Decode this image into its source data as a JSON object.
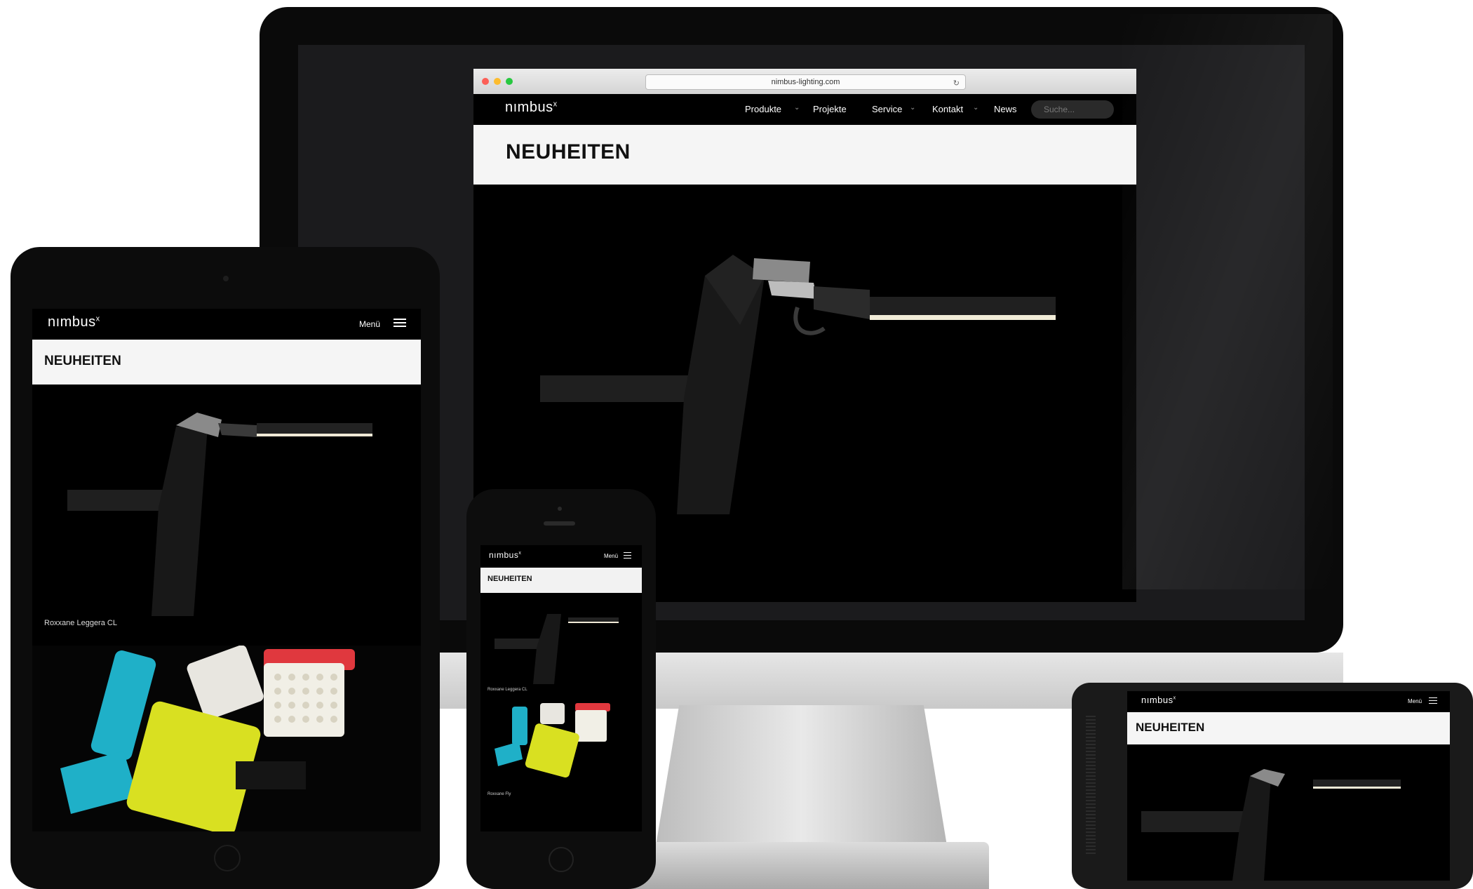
{
  "desktop": {
    "url": "nimbus-lighting.com",
    "logo": "nımbus",
    "logo_mark": "x",
    "nav": [
      "Produkte",
      "Projekte",
      "Service",
      "Kontakt",
      "News"
    ],
    "search_placeholder": "Suche...",
    "page_title": "NEUHEITEN"
  },
  "tablet": {
    "logo": "nımbus",
    "logo_mark": "x",
    "menu_label": "Menü",
    "page_title": "NEUHEITEN",
    "caption": "Roxxane Leggera CL"
  },
  "phone": {
    "logo": "nımbus",
    "logo_mark": "x",
    "menu_label": "Menü",
    "page_title": "NEUHEITEN",
    "caption_1": "Roxxane Leggera CL",
    "caption_2": "Roxxane Fly"
  },
  "landscape_phone": {
    "logo": "nımbus",
    "logo_mark": "x",
    "menu_label": "Menü",
    "page_title": "NEUHEITEN"
  },
  "colors": {
    "lamp_cyan": "#1fb0c8",
    "lamp_yellow": "#d9e021",
    "lamp_red": "#e0383e",
    "lamp_white": "#e8e6e0",
    "traffic_red": "#fc5f57",
    "traffic_yellow": "#fdbc2e",
    "traffic_green": "#28c840"
  }
}
